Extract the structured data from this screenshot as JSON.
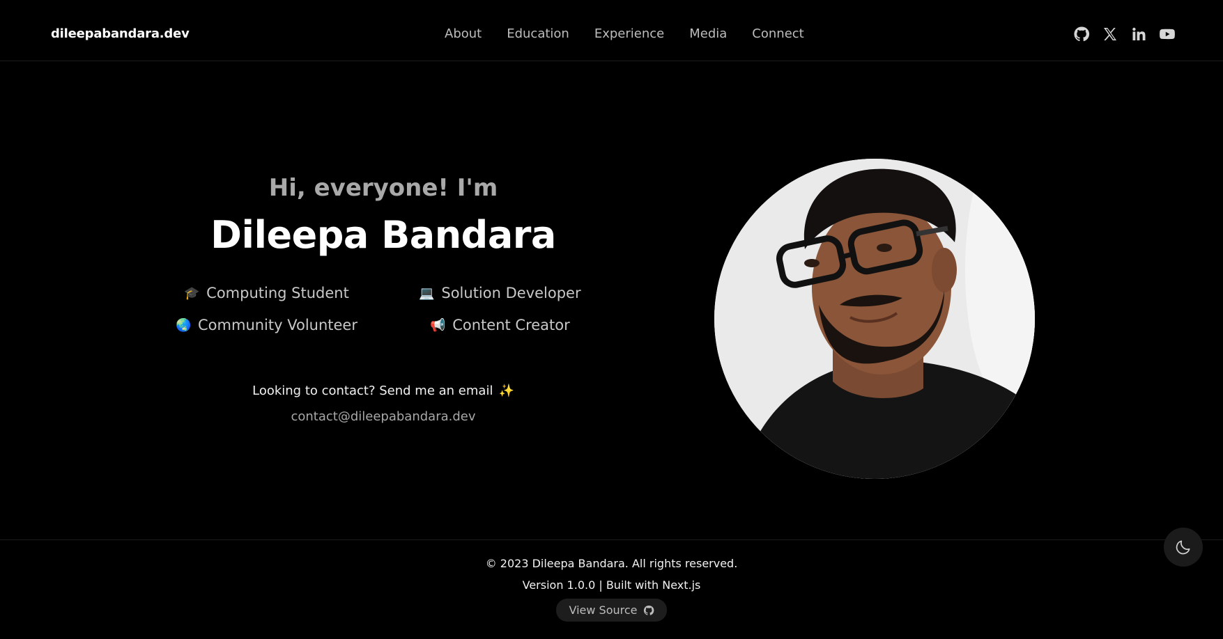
{
  "header": {
    "brand": "dileepabandara.dev",
    "nav": [
      "About",
      "Education",
      "Experience",
      "Media",
      "Connect"
    ],
    "socials": [
      "github-icon",
      "x-icon",
      "linkedin-icon",
      "youtube-icon"
    ]
  },
  "hero": {
    "greeting": "Hi, everyone! I'm",
    "name": "Dileepa Bandara",
    "roles": [
      {
        "emoji": "🎓",
        "label": "Computing Student"
      },
      {
        "emoji": "💻",
        "label": "Solution Developer"
      },
      {
        "emoji": "🌏",
        "label": "Community Volunteer"
      },
      {
        "emoji": "📢",
        "label": "Content Creator"
      }
    ],
    "contact_prompt": "Looking to contact?  Send me an email",
    "contact_emoji": "✨",
    "email": "contact@dileepabandara.dev"
  },
  "footer": {
    "copyright": "© 2023 Dileepa Bandara. All rights reserved.",
    "version": "Version 1.0.0 | Built with Next.js",
    "view_source": "View Source"
  },
  "theme_toggle": {
    "icon": "moon-icon"
  },
  "colors": {
    "background": "#000000",
    "text": "#ffffff",
    "muted": "#a9a9a9"
  }
}
